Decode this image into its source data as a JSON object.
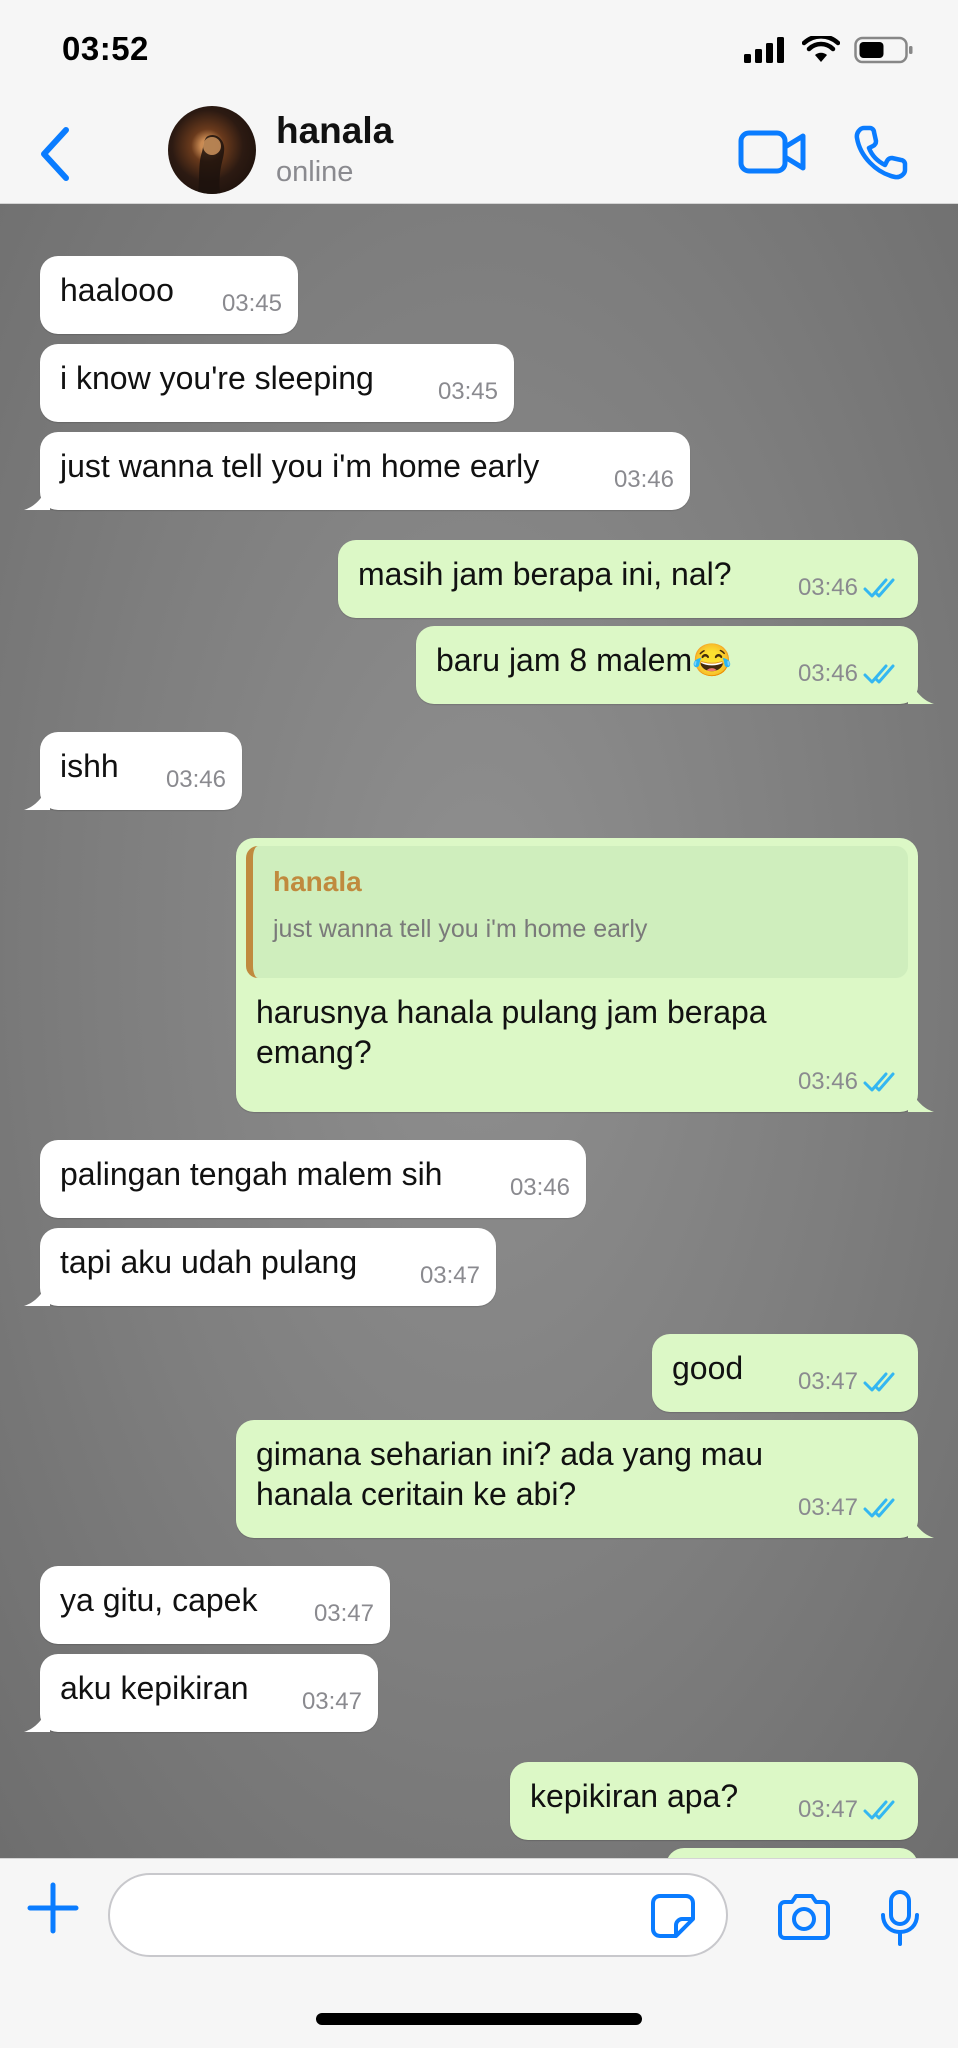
{
  "status_bar": {
    "time": "03:52"
  },
  "header": {
    "contact_name": "hanala",
    "contact_status": "online"
  },
  "messages": [
    {
      "dir": "in",
      "text": "haalooo",
      "time": "03:45"
    },
    {
      "dir": "in",
      "text": "i know you're sleeping",
      "time": "03:45"
    },
    {
      "dir": "in",
      "text": "just wanna tell you i'm home early",
      "time": "03:46"
    },
    {
      "dir": "out",
      "text": "masih jam berapa ini, nal?",
      "time": "03:46",
      "status": "read"
    },
    {
      "dir": "out",
      "text": "baru jam 8 malem😂",
      "time": "03:46",
      "status": "read"
    },
    {
      "dir": "in",
      "text": "ishh",
      "time": "03:46"
    },
    {
      "dir": "out",
      "text": "harusnya hanala pulang jam berapa emang?",
      "time": "03:46",
      "status": "read",
      "quote": {
        "author": "hanala",
        "text": "just wanna tell you i'm home early"
      }
    },
    {
      "dir": "in",
      "text": "palingan tengah malem sih",
      "time": "03:46"
    },
    {
      "dir": "in",
      "text": "tapi aku udah pulang",
      "time": "03:47"
    },
    {
      "dir": "out",
      "text": "good",
      "time": "03:47",
      "status": "read"
    },
    {
      "dir": "out",
      "text": "gimana seharian ini? ada yang mau hanala ceritain ke abi?",
      "time": "03:47",
      "status": "read"
    },
    {
      "dir": "in",
      "text": "ya gitu, capek",
      "time": "03:47"
    },
    {
      "dir": "in",
      "text": "aku kepikiran",
      "time": "03:47"
    },
    {
      "dir": "out",
      "text": "kepikiran apa?",
      "time": "03:47",
      "status": "read"
    }
  ],
  "input": {
    "value": "",
    "placeholder": ""
  },
  "icons": {
    "back": "chevron-left-icon",
    "video": "video-camera-icon",
    "call": "phone-icon",
    "plus": "plus-icon",
    "sticker": "sticker-icon",
    "camera": "camera-icon",
    "mic": "microphone-icon",
    "read_receipt": "double-check-icon"
  },
  "colors": {
    "accent": "#0a7cff",
    "incoming_bubble": "#ffffff",
    "outgoing_bubble": "#dcf8c6",
    "read_tick": "#34b7f1",
    "quote_accent": "#c08a3e",
    "timestamp": "#8a8a8f"
  }
}
